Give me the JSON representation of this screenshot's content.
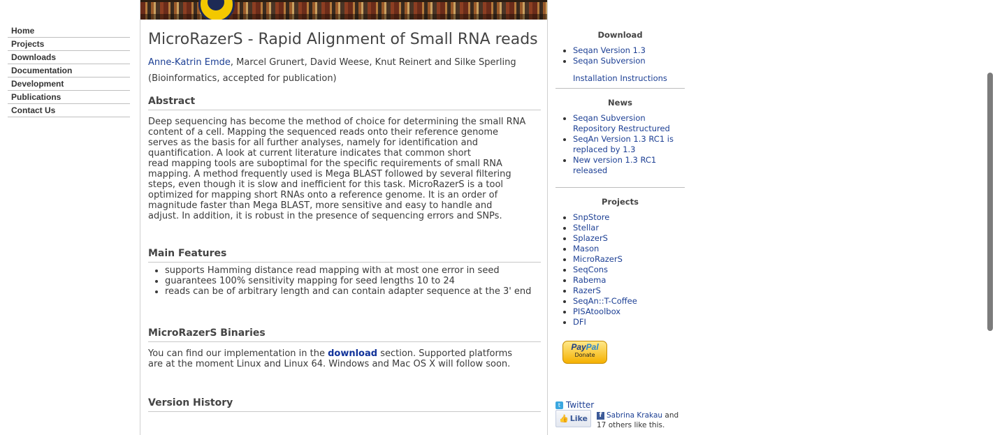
{
  "nav": {
    "items": [
      "Home",
      "Projects",
      "Downloads",
      "Documentation",
      "Development",
      "Publications",
      "Contact Us"
    ]
  },
  "article": {
    "title": "MicroRazerS - Rapid Alignment of Small RNA reads",
    "author_link": "Anne-Katrin Emde",
    "authors_rest": ", Marcel Grunert, David Weese, Knut Reinert and Silke Sperling",
    "publication": "(Bioinformatics, accepted for publication)",
    "abstract_heading": "Abstract",
    "abstract_lines": [
      "Deep sequencing has become the method of choice for determining the small RNA",
      "content of a cell. Mapping the sequenced reads onto their reference genome",
      "serves as the basis for all further analyses, namely for identification and",
      "quantification. A look at current literature indicates that common short",
      "read mapping tools are suboptimal for the specific requirements of small RNA",
      "mapping. A method frequently used is Mega BLAST followed by several filtering",
      "steps, even though it is slow and inefficient for this task. MicroRazerS is a tool",
      "optimized for mapping short RNAs onto a reference genome. It is an order of",
      "magnitude faster than Mega BLAST, more sensitive and easy to handle and",
      "adjust. In addition, it is robust in the presence of sequencing errors and SNPs."
    ],
    "features_heading": "Main Features",
    "features": [
      "supports Hamming distance read mapping with at most one error in seed",
      "guarantees 100% sensitivity mapping for seed lengths 10 to 24",
      "reads can be of arbitrary length and can contain adapter sequence at the 3' end"
    ],
    "binaries_heading": "MicroRazerS Binaries",
    "binaries_pre": "You can find our implementation in the ",
    "binaries_link": "download",
    "binaries_post_line1": " section. Supported platforms",
    "binaries_line2": "are at the moment Linux and Linux 64. Windows and Mac OS X will follow soon.",
    "history_heading": "Version History"
  },
  "sidebar": {
    "download_heading": "Download",
    "download_items": [
      "Seqan Version 1.3",
      "Seqan Subversion"
    ],
    "install_link": "Installation Instructions",
    "news_heading": "News",
    "news_items": [
      "Seqan Subversion Repository Restructured",
      "SeqAn Version 1.3 RC1 is replaced by 1.3",
      "New version 1.3 RC1 released"
    ],
    "projects_heading": "Projects",
    "projects": [
      "SnpStore",
      "Stellar",
      "SplazerS",
      "Mason",
      "MicroRazerS",
      "SeqCons",
      "Rabema",
      "RazerS",
      "SeqAn::T-Coffee",
      "PISAtoolbox",
      "DFI"
    ],
    "paypal_brand_1": "Pay",
    "paypal_brand_2": "Pal",
    "paypal_donate": "Donate",
    "twitter_label": "Twitter",
    "like_label": "Like",
    "fb_name": "Sabrina Krakau",
    "fb_and": " and",
    "fb_others": "17 others like this."
  },
  "colors": {
    "link": "#1c3f94",
    "page_bg": "#eeeeee",
    "content_bg": "#ffffff"
  }
}
